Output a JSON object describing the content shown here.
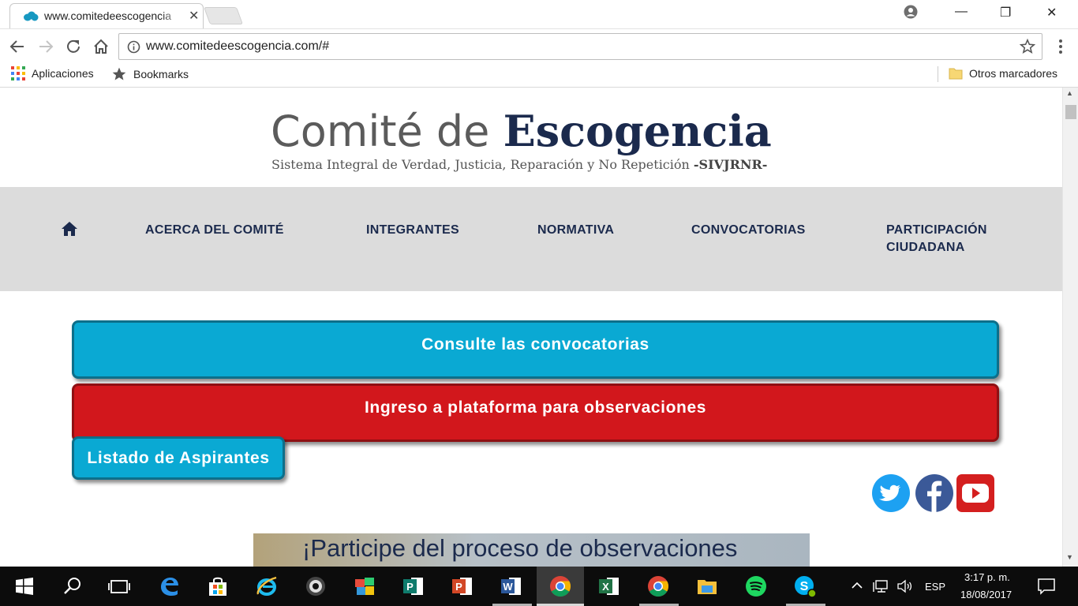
{
  "browser": {
    "tab_title": "www.comitedeescogencia",
    "tab_close": "✕",
    "url": "www.comitedeescogencia.com/#",
    "window_controls": {
      "minimize": "—",
      "restore": "❐",
      "close": "✕"
    },
    "bookmarks": {
      "apps_label": "Aplicaciones",
      "bookmarks_label": "Bookmarks",
      "other_label": "Otros marcadores"
    }
  },
  "site": {
    "logo": {
      "light_text": "Comité de ",
      "bold_text": "Escogencia",
      "subtitle": "Sistema Integral de Verdad, Justicia, Reparación y No Repetición ",
      "subtitle_acronym": "-SIVJRNR-"
    },
    "nav": {
      "items": [
        {
          "label": "ACERCA DEL COMITÉ"
        },
        {
          "label": "INTEGRANTES"
        },
        {
          "label": "NORMATIVA"
        },
        {
          "label": "CONVOCATORIAS"
        },
        {
          "label": "PARTICIPACIÓN CIUDADANA"
        }
      ]
    },
    "buttons": {
      "convocatorias": "Consulte las convocatorias",
      "observaciones": "Ingreso a plataforma para observaciones",
      "aspirantes": "Listado de Aspirantes"
    },
    "social": [
      "twitter-icon",
      "facebook-icon",
      "youtube-icon"
    ],
    "banner_text": "¡Participe del proceso de observaciones"
  },
  "taskbar": {
    "language": "ESP",
    "time": "3:17 p. m.",
    "date": "18/08/2017"
  },
  "colors": {
    "navy": "#1b2a4d",
    "cyan": "#0aa9d3",
    "red": "#d2171c",
    "nav_bg": "#dcdcdc"
  }
}
